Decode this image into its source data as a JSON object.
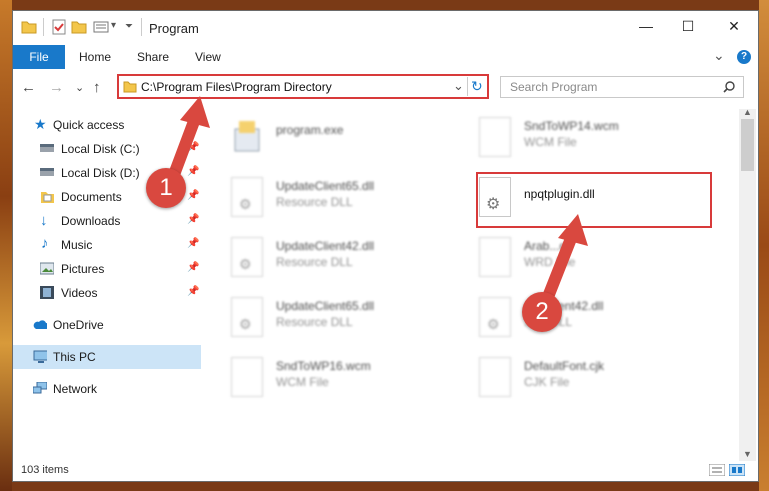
{
  "window": {
    "title": "Program",
    "controls": {
      "minimize": "—",
      "maximize": "☐",
      "close": "✕"
    }
  },
  "ribbon": {
    "tabs": [
      "File",
      "Home",
      "Share",
      "View"
    ],
    "expand_glyph": "⌄",
    "help_glyph": "?"
  },
  "address_bar": {
    "path": "C:\\Program Files\\Program Directory",
    "dropdown_glyph": "⌄",
    "refresh_glyph": "↻"
  },
  "search": {
    "placeholder": "Search Program"
  },
  "nav_pane": {
    "quick_access": "Quick access",
    "items": [
      {
        "label": "Local Disk (C:)",
        "icon": "drive-icon",
        "pinned": true
      },
      {
        "label": "Local Disk (D:)",
        "icon": "drive-icon",
        "pinned": true
      },
      {
        "label": "Documents",
        "icon": "documents-icon",
        "pinned": true
      },
      {
        "label": "Downloads",
        "icon": "download-icon",
        "pinned": true
      },
      {
        "label": "Music",
        "icon": "music-icon",
        "pinned": true
      },
      {
        "label": "Pictures",
        "icon": "pictures-icon",
        "pinned": true
      },
      {
        "label": "Videos",
        "icon": "videos-icon",
        "pinned": true
      }
    ],
    "onedrive": "OneDrive",
    "this_pc": "This PC",
    "network": "Network"
  },
  "files": [
    {
      "name": "program.exe",
      "type": "",
      "icon": "exe-icon"
    },
    {
      "name": "SndToWP14.wcm",
      "type": "WCM File",
      "icon": "document-icon"
    },
    {
      "name": "UpdateClient65.dll",
      "type": "Resource DLL",
      "icon": "gear-dll-icon"
    },
    {
      "name": "npqtplugin.dll",
      "type": "",
      "icon": "gear-dll-icon"
    },
    {
      "name": "UpdateClient42.dll",
      "type": "Resource DLL",
      "icon": "gear-dll-icon"
    },
    {
      "name": "Arab...d",
      "type": "WRD File",
      "icon": "document-icon"
    },
    {
      "name": "UpdateClient65.dll",
      "type": "Resource DLL",
      "icon": "gear-dll-icon"
    },
    {
      "name": "...teClient42.dll",
      "type": "...ce DLL",
      "icon": "gear-dll-icon"
    },
    {
      "name": "SndToWP16.wcm",
      "type": "WCM File",
      "icon": "document-icon"
    },
    {
      "name": "DefaultFont.cjk",
      "type": "CJK File",
      "icon": "document-icon"
    }
  ],
  "status_bar": {
    "item_count": "103 items"
  },
  "annotations": {
    "step1": "1",
    "step2": "2"
  },
  "colors": {
    "accent": "#1979ca",
    "highlight": "#d83a3a",
    "badge": "#d9483f",
    "selection": "#cce4f7"
  }
}
